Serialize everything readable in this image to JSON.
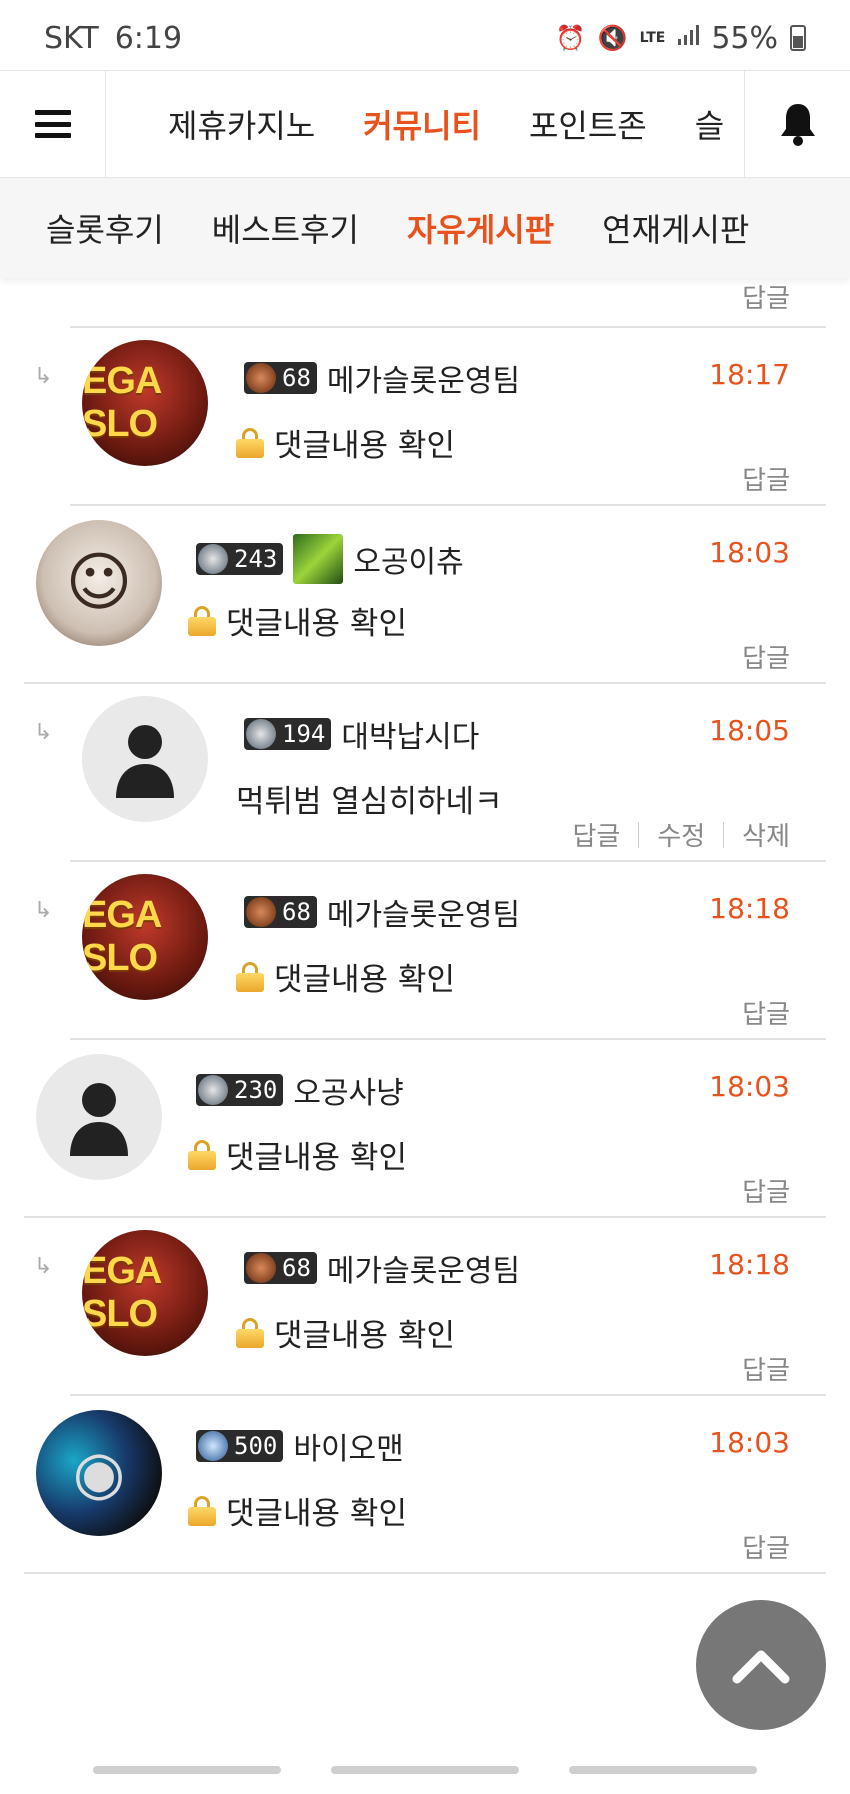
{
  "status_bar": {
    "carrier": "SKT",
    "time": "6:19",
    "battery": "55%",
    "network": "LTE"
  },
  "top_nav": {
    "tabs": [
      "제휴카지노",
      "커뮤니티",
      "포인트존",
      "슬"
    ],
    "active": "커뮤니티"
  },
  "sub_nav": {
    "tabs": [
      "슬롯후기",
      "베스트후기",
      "자유게시판",
      "연재게시판"
    ],
    "active": "자유게시판"
  },
  "labels": {
    "reply": "답글",
    "edit": "수정",
    "delete": "삭제",
    "locked": "댓글내용 확인"
  },
  "avatar_logo_text": "EGA SLO",
  "colors": {
    "accent": "#e8521d"
  },
  "comments": [
    {
      "nested": true,
      "avatar": "mega",
      "level": "68",
      "badge": "bronze",
      "nick": "메가슬롯운영팀",
      "time": "18:17",
      "text": "댓글내용 확인",
      "locked": true
    },
    {
      "nested": false,
      "avatar": "drawn",
      "level": "243",
      "badge": "silver",
      "nick": "오공이츄",
      "time": "18:03",
      "text": "댓글내용 확인",
      "locked": true,
      "userpic": true
    },
    {
      "nested": true,
      "avatar": "default",
      "level": "194",
      "badge": "silver",
      "nick": "대박납시다",
      "time": "18:05",
      "text": "먹튀범 열심히하네ㅋ",
      "locked": false,
      "own": true
    },
    {
      "nested": true,
      "avatar": "mega",
      "level": "68",
      "badge": "bronze",
      "nick": "메가슬롯운영팀",
      "time": "18:18",
      "text": "댓글내용 확인",
      "locked": true
    },
    {
      "nested": false,
      "avatar": "default",
      "level": "230",
      "badge": "silver",
      "nick": "오공사냥",
      "time": "18:03",
      "text": "댓글내용 확인",
      "locked": true
    },
    {
      "nested": true,
      "avatar": "mega",
      "level": "68",
      "badge": "bronze",
      "nick": "메가슬롯운영팀",
      "time": "18:18",
      "text": "댓글내용 확인",
      "locked": true
    },
    {
      "nested": false,
      "avatar": "bio",
      "level": "500",
      "badge": "gold",
      "nick": "바이오맨",
      "time": "18:03",
      "text": "댓글내용 확인",
      "locked": true
    }
  ]
}
